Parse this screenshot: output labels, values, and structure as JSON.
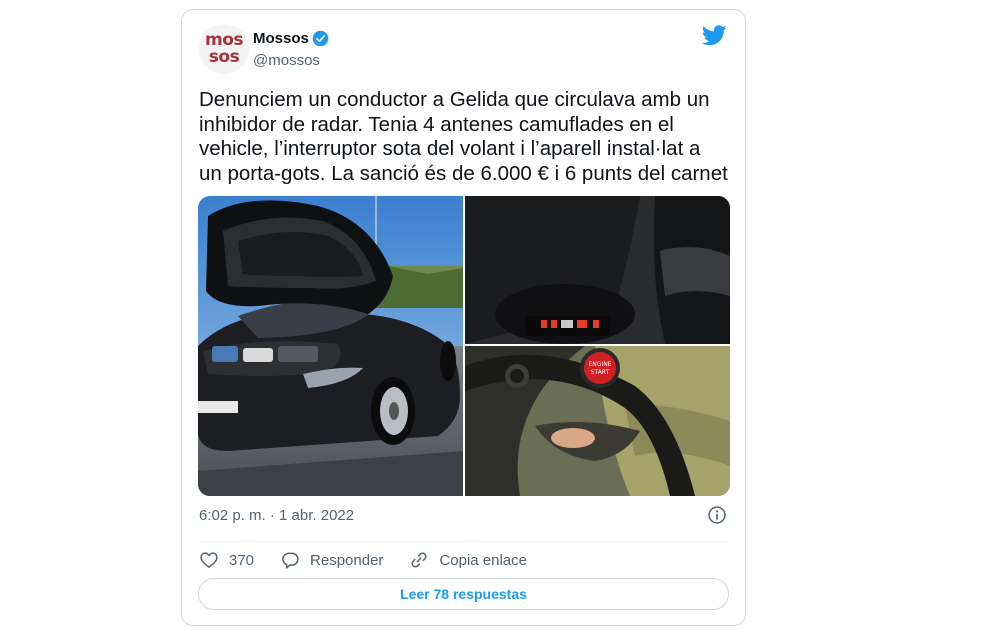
{
  "tweet": {
    "avatar_text_top": "mos",
    "avatar_text_bottom": "sos",
    "author_name": "Mossos",
    "author_handle": "@mossos",
    "text": "Denunciem un conductor a Gelida que circulava amb un\ninhibidor de radar. Tenia 4 antenes camuflades en el\nvehicle, l’interruptor sota del volant i l’aparell instal·lat a\nun porta-gots. La sanció és de 6.000 € i 6 punts del carnet",
    "engine_button_text_1": "ENGINE",
    "engine_button_text_2": "START",
    "timestamp": "6:02 p. m. · 1 abr. 2022",
    "like_count": "370",
    "reply_label": "Responder",
    "copy_link_label": "Copia enlace",
    "read_replies_label": "Leer 78 respuestas"
  },
  "icons": {
    "verified": "verified-badge-icon",
    "twitter": "twitter-bird-icon",
    "info": "info-icon",
    "like": "heart-icon",
    "reply": "speech-bubble-icon",
    "copy_link": "link-icon"
  },
  "colors": {
    "accent": "#1d9bf0",
    "avatar_text": "#a7343a",
    "secondary_text": "#536471",
    "border": "#cfd9de"
  }
}
